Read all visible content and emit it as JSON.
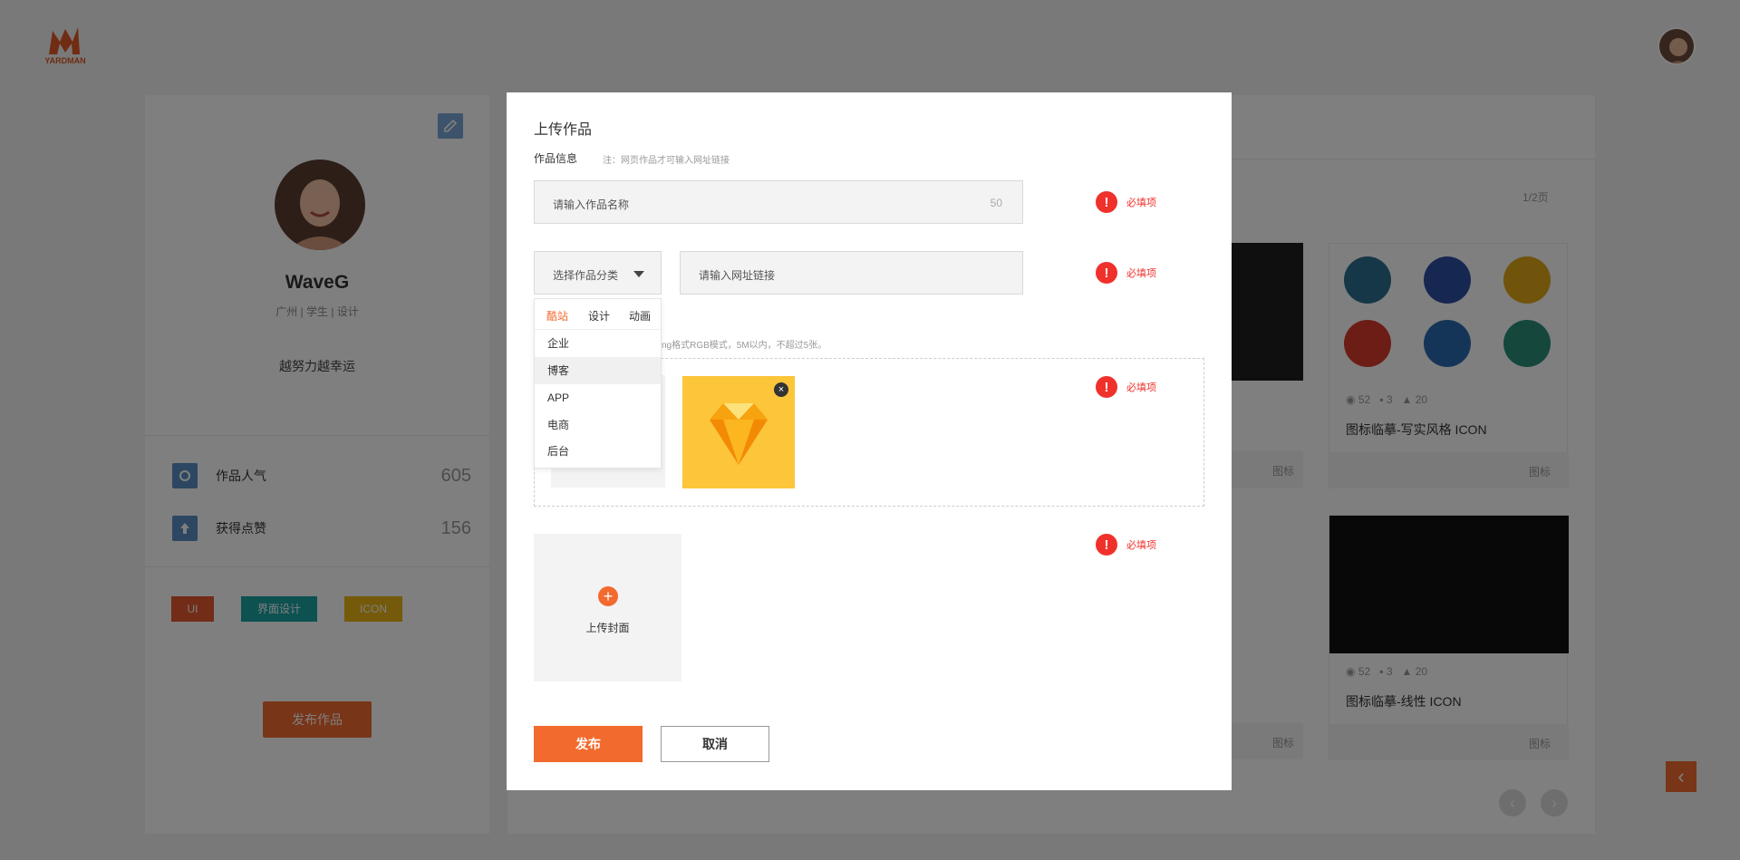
{
  "logo": {
    "word": "YARDMAN"
  },
  "profile": {
    "name": "WaveG",
    "meta": "广州 | 学生 | 设计",
    "motto": "越努力越幸运",
    "stats": [
      {
        "label": "作品人气",
        "value": "605"
      },
      {
        "label": "获得点赞",
        "value": "156"
      }
    ],
    "tags": [
      {
        "label": "UI",
        "color": "#e5582e"
      },
      {
        "label": "界面设计",
        "color": "#1aa3a3"
      },
      {
        "label": "ICON",
        "color": "#e8b515"
      }
    ],
    "publish_label": "发布作品"
  },
  "works": {
    "page_indicator": "1/2页",
    "cards": [
      {
        "views": "52",
        "comments": "3",
        "likes": "20",
        "title": "图标临摹-写实风格 ICON",
        "category": "图标"
      },
      {
        "views": "52",
        "comments": "3",
        "likes": "20",
        "title": "图标临摹-线性 ICON",
        "category": "图标"
      }
    ],
    "partial_category": "图标",
    "pager_prev": "‹",
    "pager_next": "›",
    "back_top": "‹"
  },
  "modal": {
    "title": "上传作品",
    "section_label": "作品信息",
    "note": "注：网页作品才可输入网址链接",
    "name_placeholder": "请输入作品名称",
    "name_counter": "50",
    "category_placeholder": "选择作品分类",
    "url_placeholder": "请输入网址链接",
    "required_text": "必填项",
    "upload_hint": "ng格式RGB模式，5M以内，不超过5张。",
    "cover_label": "上传封面",
    "publish_button": "发布",
    "cancel_button": "取消",
    "dropdown": {
      "tabs": [
        "酷站",
        "设计",
        "动画"
      ],
      "active_tab": "酷站",
      "items": [
        "企业",
        "博客",
        "APP",
        "电商",
        "后台"
      ],
      "hovered_item": "博客"
    }
  },
  "colors": {
    "accent": "#f26a2e",
    "required": "#f0302b"
  }
}
